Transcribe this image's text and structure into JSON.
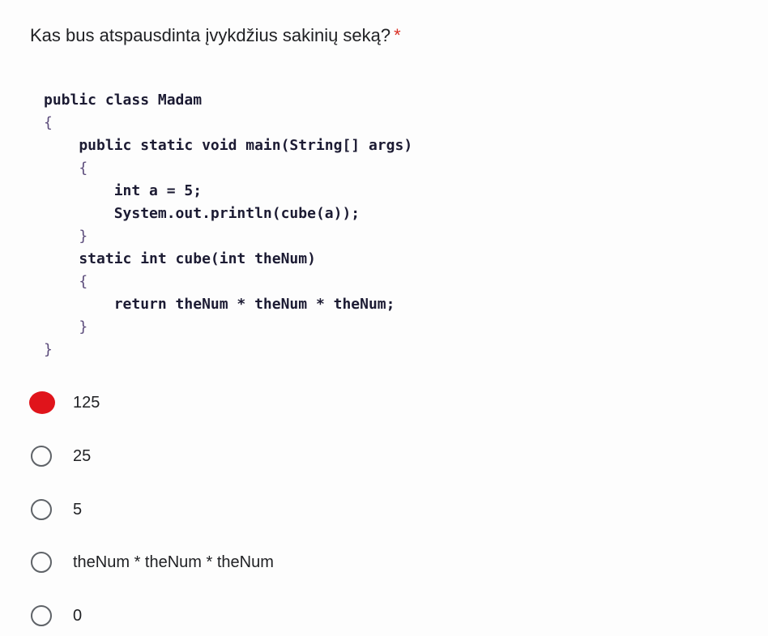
{
  "question": {
    "text": "Kas bus atspausdinta įvykdžius sakinių seką?",
    "required_marker": "*"
  },
  "code": {
    "lines": [
      "public class Madam",
      "{",
      "    public static void main(String[] args)",
      "    {",
      "        int a = 5;",
      "        System.out.println(cube(a));",
      "    }",
      "    static int cube(int theNum)",
      "    {",
      "        return theNum * theNum * theNum;",
      "    }",
      "}"
    ]
  },
  "options": [
    {
      "label": "125",
      "selected": true
    },
    {
      "label": "25",
      "selected": false
    },
    {
      "label": "5",
      "selected": false
    },
    {
      "label": "theNum * theNum * theNum",
      "selected": false
    },
    {
      "label": "0",
      "selected": false
    }
  ],
  "colors": {
    "accent": "#e0141b",
    "required": "#d93025",
    "radio_border": "#5f6368"
  }
}
